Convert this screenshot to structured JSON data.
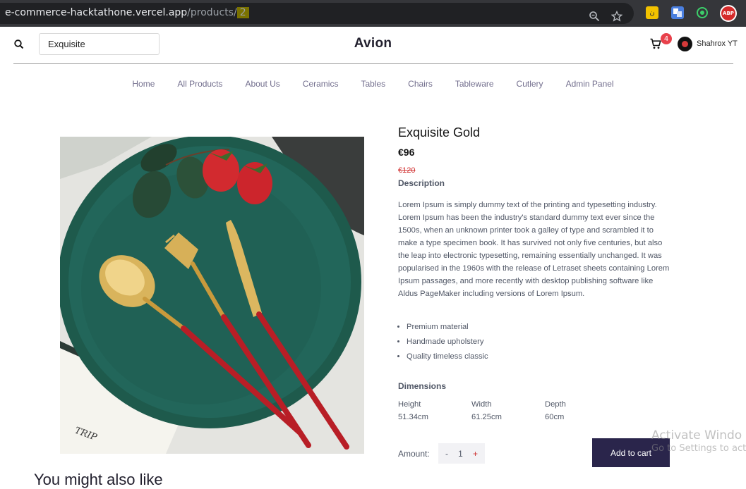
{
  "browser": {
    "url_main": "e-commerce-hacktathone.vercel.app",
    "url_path": "/products/",
    "url_id": "2"
  },
  "header": {
    "search_value": "Exquisite",
    "brand": "Avion",
    "cart_count": "4",
    "user_name": "Shahrox YT"
  },
  "nav": {
    "items": [
      "Home",
      "All Products",
      "About Us",
      "Ceramics",
      "Tables",
      "Chairs",
      "Tableware",
      "Cutlery",
      "Admin Panel"
    ]
  },
  "product": {
    "title": "Exquisite Gold",
    "price": "€96",
    "old_price": "€120",
    "description_heading": "Description",
    "description": "Lorem Ipsum is simply dummy text of the printing and typesetting industry. Lorem Ipsum has been the industry's standard dummy text ever since the 1500s, when an unknown printer took a galley of type and scrambled it to make a type specimen book. It has survived not only five centuries, but also the leap into electronic typesetting, remaining essentially unchanged. It was popularised in the 1960s with the release of Letraset sheets containing Lorem Ipsum passages, and more recently with desktop publishing software like Aldus PageMaker including versions of Lorem Ipsum.",
    "features": [
      "Premium material",
      "Handmade upholstery",
      "Quality timeless classic"
    ],
    "dimensions_heading": "Dimensions",
    "dimensions": [
      {
        "label": "Height",
        "value": "51.34cm"
      },
      {
        "label": "Width",
        "value": "61.25cm"
      },
      {
        "label": "Depth",
        "value": "60cm"
      }
    ],
    "amount_label": "Amount:",
    "quantity": "1",
    "minus": "-",
    "plus": "+",
    "add_to_cart": "Add to cart",
    "image_text": "TRIP"
  },
  "watermark": {
    "line1": "Activate Windo",
    "line2": "Go to Settings to act"
  },
  "below_fold_heading": "You might also like"
}
